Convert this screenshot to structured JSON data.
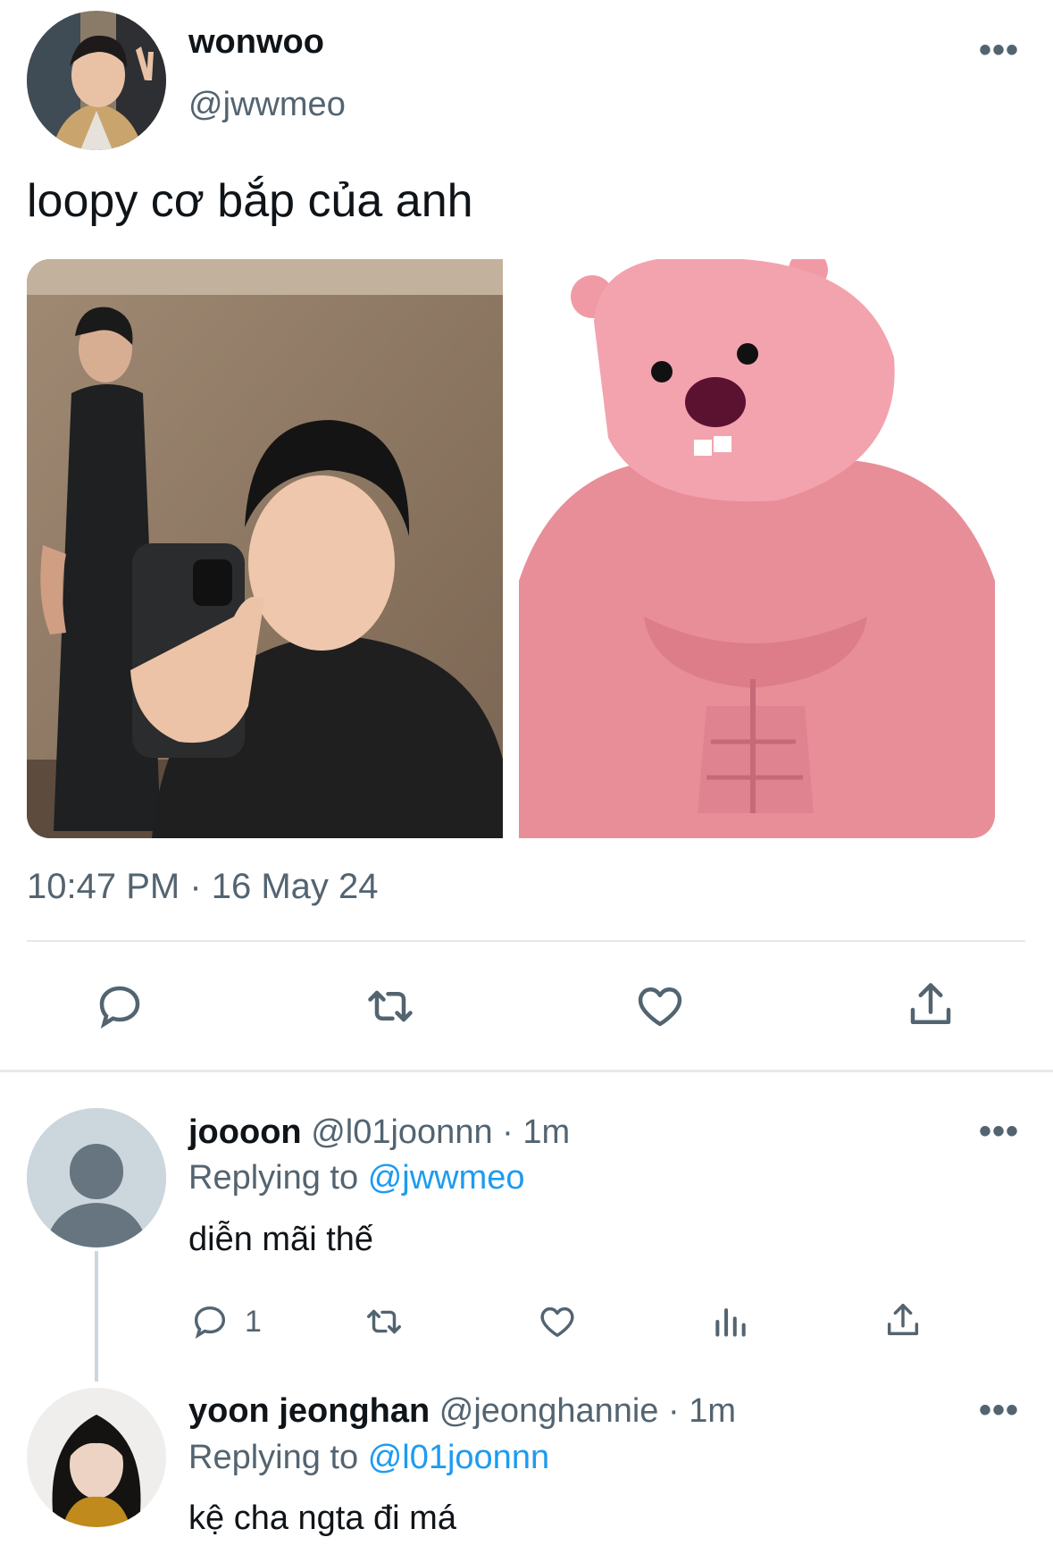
{
  "tweet": {
    "author_name": "wonwoo",
    "author_handle": "@jwwmeo",
    "text": "loopy cơ bắp của anh",
    "timestamp": "10:47 PM · 16 May 24"
  },
  "replies": [
    {
      "name": "joooon",
      "handle": "@l01joonnn",
      "time": "· 1m",
      "replying_prefix": "Replying to",
      "replying_to": "@jwwmeo",
      "text": "diễn mãi thế",
      "reply_count": "1"
    },
    {
      "name": "yoon jeonghan",
      "handle": "@jeonghannie",
      "time": "· 1m",
      "replying_prefix": "Replying to",
      "replying_to": "@l01joonnn",
      "text": "kệ cha ngta đi má"
    }
  ],
  "colors": {
    "accent": "#1d9bf0",
    "muted": "#536471",
    "divider": "#e6e9ec"
  }
}
